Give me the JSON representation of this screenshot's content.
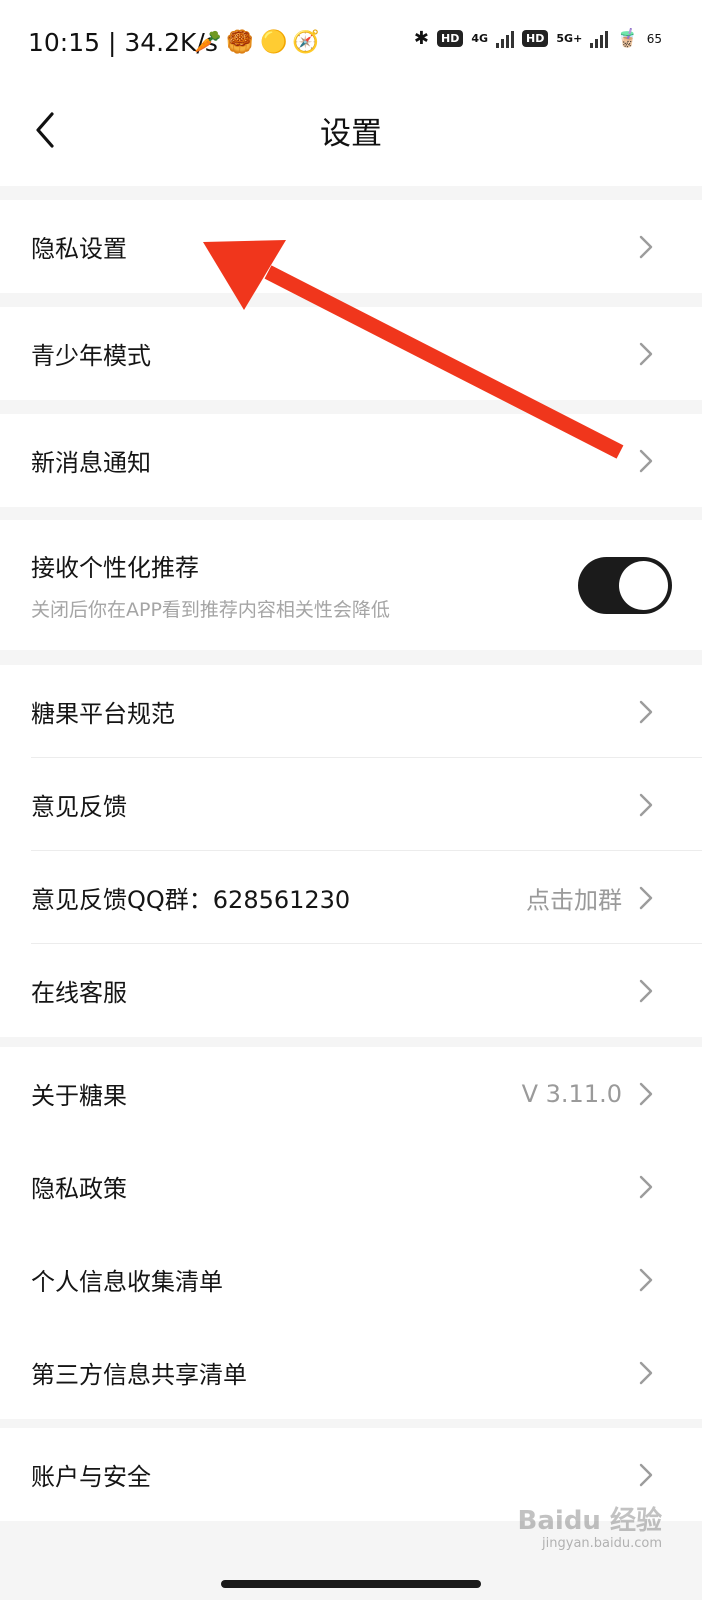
{
  "status_bar": {
    "time_speed": "10:15 | 34.2K/s",
    "hd_label": "HD",
    "net_4g": "4G",
    "net_5g": "5G+",
    "battery": "65"
  },
  "header": {
    "title": "设置"
  },
  "groups": {
    "privacy": {
      "label": "隐私设置"
    },
    "teen": {
      "label": "青少年模式"
    },
    "notify": {
      "label": "新消息通知"
    },
    "recommend": {
      "label": "接收个性化推荐",
      "subtitle": "关闭后你在APP看到推荐内容相关性会降低",
      "enabled": true
    },
    "info": [
      {
        "label": "糖果平台规范",
        "value": ""
      },
      {
        "label": "意见反馈",
        "value": ""
      },
      {
        "label": "意见反馈QQ群：628561230",
        "value": "点击加群"
      },
      {
        "label": "在线客服",
        "value": ""
      }
    ],
    "about": [
      {
        "label": "关于糖果",
        "value": "V 3.11.0"
      },
      {
        "label": "隐私政策",
        "value": ""
      },
      {
        "label": "个人信息收集清单",
        "value": ""
      },
      {
        "label": "第三方信息共享清单",
        "value": ""
      }
    ],
    "account": {
      "label": "账户与安全"
    }
  },
  "watermark": {
    "brand": "Baidu 经验",
    "url": "jingyan.baidu.com"
  },
  "annotation": {
    "arrow_color": "#f0361c"
  }
}
